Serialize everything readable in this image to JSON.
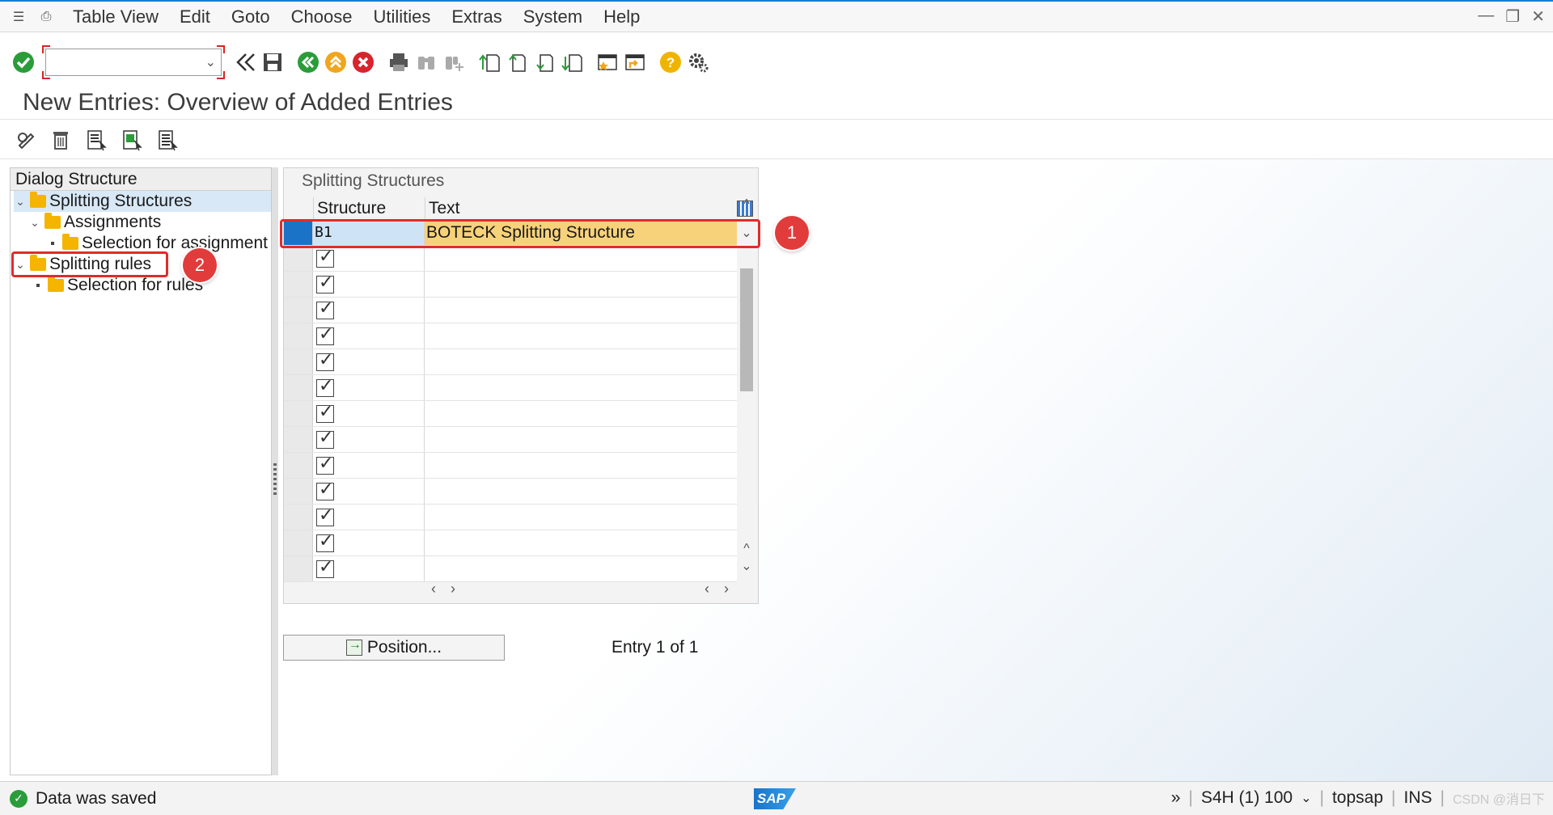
{
  "menu": {
    "items": [
      "Table View",
      "Edit",
      "Goto",
      "Choose",
      "Utilities",
      "Extras",
      "System",
      "Help"
    ]
  },
  "toolbar": {
    "command_field_value": "",
    "icons": [
      "enter-icon",
      "back-double-icon",
      "save-icon",
      "back-icon",
      "exit-icon",
      "cancel-icon",
      "print-icon",
      "find-icon",
      "find-next-icon",
      "first-page-icon",
      "previous-page-icon",
      "next-page-icon",
      "last-page-icon",
      "create-session-icon",
      "shortcut-icon",
      "help-icon",
      "customize-icon"
    ]
  },
  "page": {
    "title": "New Entries: Overview of Added Entries"
  },
  "app_toolbar": {
    "icons": [
      "display-change-icon",
      "delete-icon",
      "select-all-icon",
      "select-block-icon",
      "deselect-all-icon"
    ]
  },
  "dialog_structure": {
    "header": "Dialog Structure",
    "nodes": [
      {
        "label": "Splitting Structures",
        "level": 0,
        "expanded": true,
        "selected": true
      },
      {
        "label": "Assignments",
        "level": 1,
        "expanded": true
      },
      {
        "label": "Selection for assignment",
        "level": 2
      },
      {
        "label": "Splitting rules",
        "level": 0,
        "expanded": true
      },
      {
        "label": "Selection for rules",
        "level": 1
      }
    ]
  },
  "table": {
    "caption": "Splitting Structures",
    "columns": [
      "Structure",
      "Text"
    ],
    "rows": [
      {
        "structure": "B1",
        "text": "BOTECK  Splitting Structure"
      }
    ],
    "empty_rows": 13
  },
  "annotations": {
    "badge1": "1",
    "badge2": "2"
  },
  "footer": {
    "position_button": "Position...",
    "entry_count": "Entry 1 of 1"
  },
  "status": {
    "message": "Data was saved",
    "sap_logo": "SAP",
    "system": "S4H (1) 100",
    "user": "topsap",
    "mode": "INS",
    "watermark": "CSDN @消日下"
  },
  "colors": {
    "accent": "#1b7bd3",
    "highlight": "#e12b2b",
    "selected_row": "#f7d27a",
    "status_ok": "#2a9c3a"
  }
}
